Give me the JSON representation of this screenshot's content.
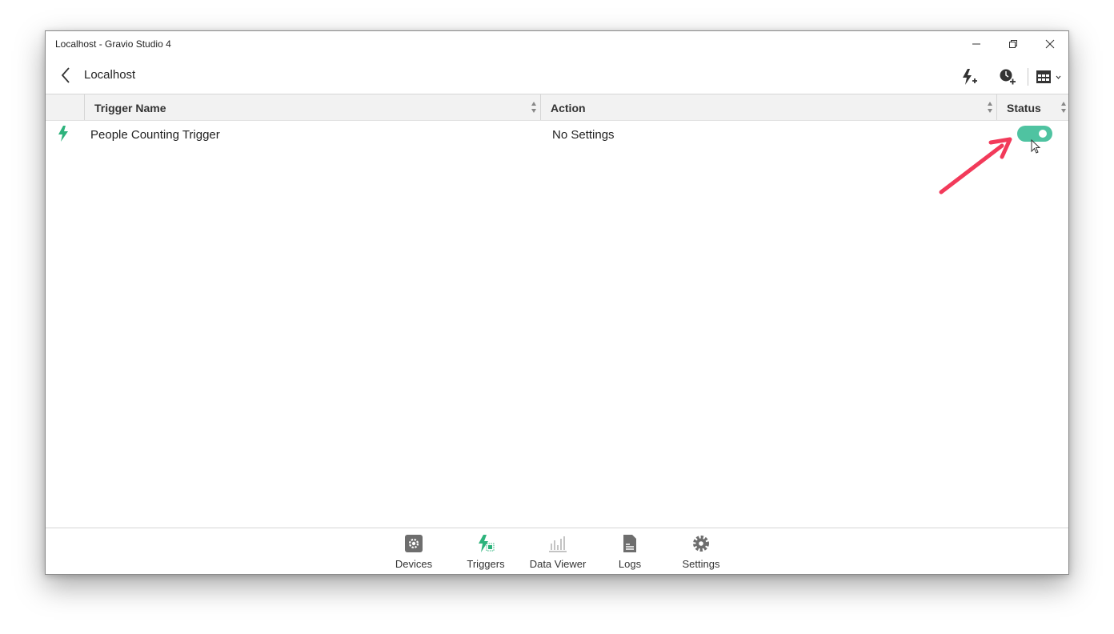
{
  "window": {
    "title": "Localhost - Gravio Studio 4"
  },
  "header": {
    "title": "Localhost",
    "icons": [
      "add-trigger-icon",
      "add-timer-icon",
      "layout-icon"
    ]
  },
  "table": {
    "columns": {
      "name": "Trigger Name",
      "action": "Action",
      "status": "Status"
    },
    "rows": [
      {
        "icon": "lightning-icon",
        "name": "People Counting Trigger",
        "action": "No Settings",
        "status_enabled": true
      }
    ]
  },
  "nav": {
    "items": [
      {
        "label": "Devices",
        "icon": "device-gear-icon"
      },
      {
        "label": "Triggers",
        "icon": "triggers-icon",
        "active": true
      },
      {
        "label": "Data Viewer",
        "icon": "bar-chart-icon"
      },
      {
        "label": "Logs",
        "icon": "document-icon"
      },
      {
        "label": "Settings",
        "icon": "gear-icon"
      }
    ]
  },
  "colors": {
    "accent": "#4fc3a1",
    "trigger_green": "#2db37c",
    "annotation_arrow": "#f23a5a",
    "icon_gray": "#6e6e6e"
  }
}
